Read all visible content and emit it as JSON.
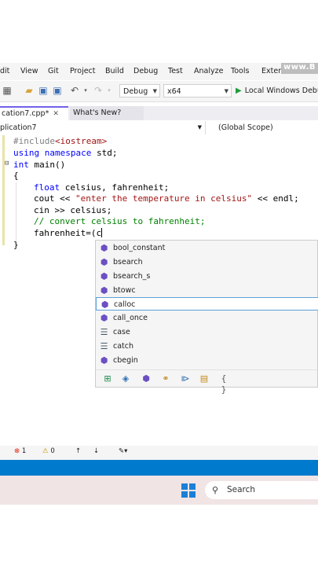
{
  "menu": {
    "items": [
      "dit",
      "View",
      "Git",
      "Project",
      "Build",
      "Debug",
      "Test",
      "Analyze",
      "Tools",
      "Extens"
    ],
    "watermark": "www.B"
  },
  "toolbar": {
    "config": "Debug",
    "platform": "x64",
    "run_label": "Local Windows Debu"
  },
  "tabs": {
    "active": "cation7.cpp*",
    "second": "What's New?"
  },
  "navbar": {
    "project": "plication7",
    "scope": "(Global Scope)"
  },
  "code": {
    "line1_pp": "#include",
    "line1_inc": "<iostream>",
    "line2_kw": "using namespace",
    "line2_rest": " std;",
    "line3_kw": "int",
    "line3_rest": " main()",
    "line4": "{",
    "line5_kw": "float",
    "line5_rest": " celsius, fahrenheit;",
    "line6_a": "cout << ",
    "line6_str": "\"enter the temperature in celsius\"",
    "line6_b": " << endl;",
    "line7": "cin >> celsius;",
    "line8_cmt": "// convert celsius to fahrenheit;",
    "line9": "fahrenheit=(c",
    "line10": "}"
  },
  "intellisense": {
    "items": [
      "bool_constant",
      "bsearch",
      "bsearch_s",
      "btowc",
      "calloc",
      "call_once",
      "case",
      "catch",
      "cbegin"
    ],
    "selected_index": 4
  },
  "status": {
    "errors": "1",
    "warnings": "0"
  },
  "taskbar": {
    "search_placeholder": "Search"
  }
}
